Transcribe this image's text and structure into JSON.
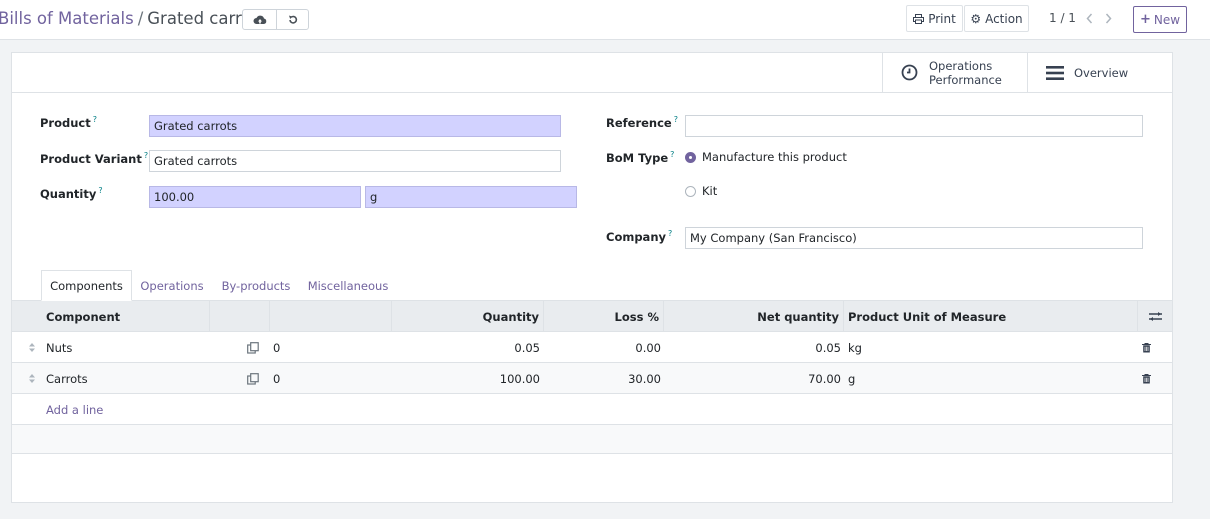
{
  "breadcrumb": {
    "parent": "Bills of Materials",
    "separator": "/",
    "current": "Grated carrots"
  },
  "toolbar": {
    "print_label": "Print",
    "action_label": "Action",
    "pager": "1 / 1",
    "new_label": "New"
  },
  "smart_buttons": {
    "operations_line1": "Operations",
    "operations_line2": "Performance",
    "overview_label": "Overview"
  },
  "form": {
    "product_label": "Product",
    "product_value": "Grated carrots",
    "variant_label": "Product Variant",
    "variant_value": "Grated carrots",
    "quantity_label": "Quantity",
    "quantity_value": "100.00",
    "uom_value": "g",
    "reference_label": "Reference",
    "reference_value": "",
    "bom_type_label": "BoM Type",
    "bom_type_option1": "Manufacture this product",
    "bom_type_option2": "Kit",
    "bom_type_selected": "Manufacture this product",
    "company_label": "Company",
    "company_value": "My Company (San Francisco)",
    "help_mark": "?"
  },
  "tabs": [
    "Components",
    "Operations",
    "By-products",
    "Miscellaneous"
  ],
  "table": {
    "headers": {
      "component": "Component",
      "quantity": "Quantity",
      "loss": "Loss %",
      "net": "Net quantity",
      "uom": "Product Unit of Measure"
    },
    "rows": [
      {
        "component": "Nuts",
        "count": "0",
        "quantity": "0.05",
        "loss": "0.00",
        "net": "0.05",
        "uom": "kg"
      },
      {
        "component": "Carrots",
        "count": "0",
        "quantity": "100.00",
        "loss": "30.00",
        "net": "70.00",
        "uom": "g"
      }
    ],
    "add_line": "Add a line"
  },
  "colors": {
    "accent": "#71639e",
    "required_field": "#d2d2ff"
  }
}
